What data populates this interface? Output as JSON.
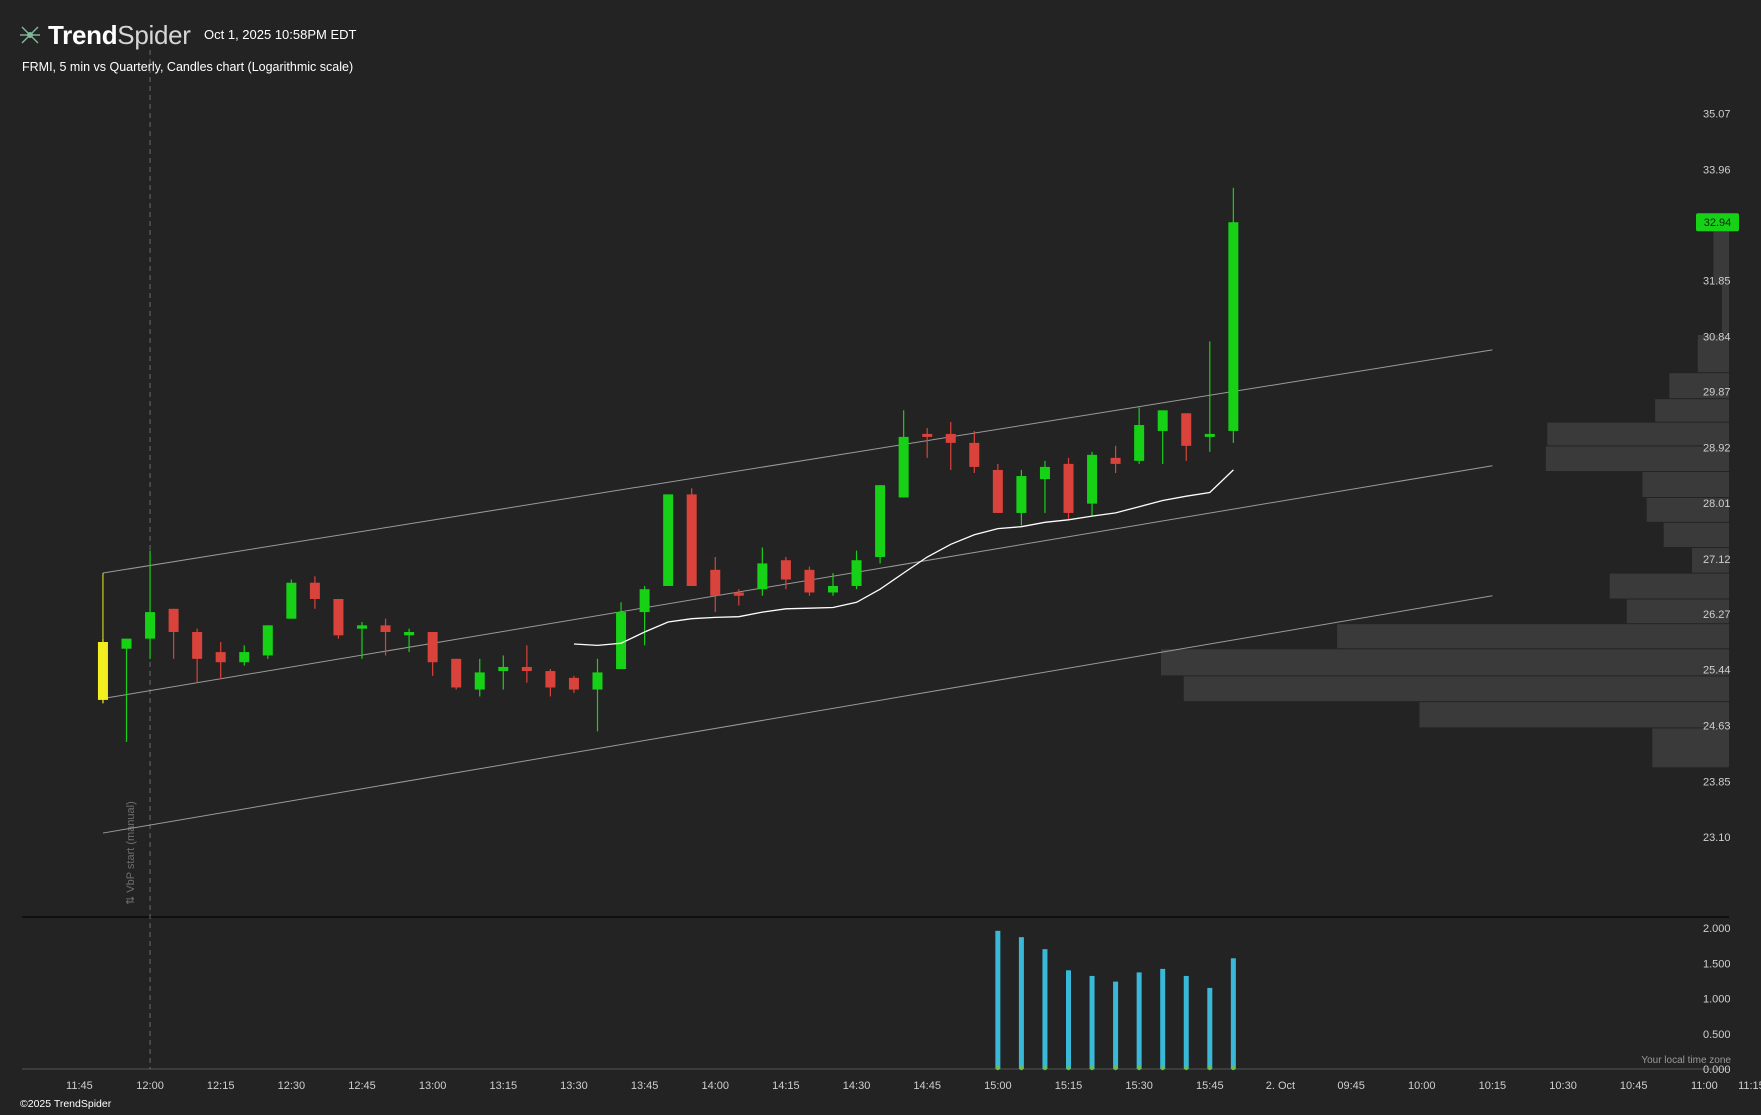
{
  "header": {
    "brand_bold": "Trend",
    "brand_light": "Spider",
    "datetime": "Oct 1, 2025 10:58PM EDT",
    "subtitle": "FRMI, 5 min vs Quarterly, Candles chart (Logarithmic scale)"
  },
  "footer": {
    "copyright": "©2025 TrendSpider",
    "timezone_note": "Your local time zone"
  },
  "annotation": {
    "vbp_label": "⇅ VbP start (manual)"
  },
  "colors": {
    "background": "#232323",
    "up": "#17d117",
    "down": "#d9433b",
    "highlight": "#f2ee20",
    "price_badge": "#17d117",
    "volume_bar": "#3ab8d8",
    "channel": "#9a9a9a",
    "vwap_line": "#ffffff",
    "profile_bar": "#3a3a3a"
  },
  "chart_data": [
    {
      "type": "candlestick",
      "title": "FRMI, 5 min vs Quarterly, Candles chart (Logarithmic scale)",
      "y_scale": "log",
      "ylim": [
        22.6,
        35.4
      ],
      "y_ticks": [
        "35.07",
        "33.96",
        "32.94",
        "31.85",
        "30.84",
        "29.87",
        "28.92",
        "28.01",
        "27.12",
        "26.27",
        "25.44",
        "24.63",
        "23.85",
        "23.10"
      ],
      "last_price": "32.94",
      "x_ticks": [
        "11:45",
        "12:00",
        "12:15",
        "12:30",
        "12:45",
        "13:00",
        "13:15",
        "13:30",
        "13:45",
        "14:00",
        "14:15",
        "14:30",
        "14:45",
        "15:00",
        "15:15",
        "15:30",
        "15:45",
        "2. Oct",
        "09:45",
        "10:00",
        "10:15",
        "10:30",
        "10:45",
        "11:00",
        "11:15"
      ],
      "x_tick_slots": [
        -2,
        1,
        4,
        7,
        10,
        13,
        16,
        19,
        22,
        25,
        28,
        31,
        34,
        37,
        40,
        43,
        46,
        49,
        52,
        55,
        58,
        61,
        64,
        67,
        69
      ],
      "candles": [
        {
          "t": "11:55",
          "o": 25.0,
          "h": 25.9,
          "l": 24.95,
          "c": 25.85,
          "highlight": true
        },
        {
          "t": "12:00",
          "o": 25.75,
          "h": 25.9,
          "l": 24.4,
          "c": 25.9
        },
        {
          "t": "12:05",
          "o": 25.9,
          "h": 27.25,
          "l": 25.6,
          "c": 26.3
        },
        {
          "t": "12:10",
          "o": 26.35,
          "h": 26.35,
          "l": 25.6,
          "c": 26.0
        },
        {
          "t": "12:15",
          "o": 26.0,
          "h": 26.05,
          "l": 25.25,
          "c": 25.6
        },
        {
          "t": "12:20",
          "o": 25.7,
          "h": 25.85,
          "l": 25.3,
          "c": 25.55
        },
        {
          "t": "12:25",
          "o": 25.55,
          "h": 25.8,
          "l": 25.5,
          "c": 25.7
        },
        {
          "t": "12:30",
          "o": 25.65,
          "h": 26.1,
          "l": 25.6,
          "c": 26.1
        },
        {
          "t": "12:35",
          "o": 26.2,
          "h": 26.8,
          "l": 26.2,
          "c": 26.75
        },
        {
          "t": "12:40",
          "o": 26.75,
          "h": 26.85,
          "l": 26.35,
          "c": 26.5
        },
        {
          "t": "12:45",
          "o": 26.5,
          "h": 26.5,
          "l": 25.9,
          "c": 25.95
        },
        {
          "t": "12:50",
          "o": 26.05,
          "h": 26.15,
          "l": 25.6,
          "c": 26.1
        },
        {
          "t": "12:55",
          "o": 26.1,
          "h": 26.2,
          "l": 25.65,
          "c": 26.0
        },
        {
          "t": "13:00",
          "o": 25.95,
          "h": 26.05,
          "l": 25.7,
          "c": 26.0
        },
        {
          "t": "13:05",
          "o": 26.0,
          "h": 26.0,
          "l": 25.35,
          "c": 25.55
        },
        {
          "t": "13:10",
          "o": 25.6,
          "h": 25.6,
          "l": 25.15,
          "c": 25.18
        },
        {
          "t": "13:15",
          "o": 25.15,
          "h": 25.6,
          "l": 25.05,
          "c": 25.4
        },
        {
          "t": "13:20",
          "o": 25.42,
          "h": 25.65,
          "l": 25.15,
          "c": 25.48
        },
        {
          "t": "13:25",
          "o": 25.48,
          "h": 25.8,
          "l": 25.25,
          "c": 25.42
        },
        {
          "t": "13:30",
          "o": 25.42,
          "h": 25.45,
          "l": 25.05,
          "c": 25.18
        },
        {
          "t": "13:35",
          "o": 25.32,
          "h": 25.35,
          "l": 25.1,
          "c": 25.15
        },
        {
          "t": "13:40",
          "o": 25.15,
          "h": 25.6,
          "l": 24.55,
          "c": 25.4
        },
        {
          "t": "13:45",
          "o": 25.45,
          "h": 26.45,
          "l": 25.45,
          "c": 26.3
        },
        {
          "t": "13:50",
          "o": 26.3,
          "h": 26.7,
          "l": 25.8,
          "c": 26.65
        },
        {
          "t": "13:55",
          "o": 26.7,
          "h": 28.15,
          "l": 26.7,
          "c": 28.15
        },
        {
          "t": "14:00",
          "o": 28.15,
          "h": 28.25,
          "l": 26.7,
          "c": 26.7
        },
        {
          "t": "14:05",
          "o": 26.95,
          "h": 27.15,
          "l": 26.3,
          "c": 26.55
        },
        {
          "t": "14:10",
          "o": 26.6,
          "h": 26.65,
          "l": 26.4,
          "c": 26.55
        },
        {
          "t": "14:15",
          "o": 26.65,
          "h": 27.3,
          "l": 26.55,
          "c": 27.05
        },
        {
          "t": "14:20",
          "o": 27.1,
          "h": 27.15,
          "l": 26.65,
          "c": 26.8
        },
        {
          "t": "14:25",
          "o": 26.95,
          "h": 27.0,
          "l": 26.55,
          "c": 26.6
        },
        {
          "t": "14:30",
          "o": 26.6,
          "h": 26.9,
          "l": 26.55,
          "c": 26.7
        },
        {
          "t": "14:35",
          "o": 26.7,
          "h": 27.25,
          "l": 26.65,
          "c": 27.1
        },
        {
          "t": "14:40",
          "o": 27.15,
          "h": 28.3,
          "l": 27.05,
          "c": 28.3
        },
        {
          "t": "14:45",
          "o": 28.1,
          "h": 29.55,
          "l": 28.1,
          "c": 29.1
        },
        {
          "t": "14:50",
          "o": 29.15,
          "h": 29.25,
          "l": 28.75,
          "c": 29.1
        },
        {
          "t": "14:55",
          "o": 29.15,
          "h": 29.35,
          "l": 28.55,
          "c": 29.0
        },
        {
          "t": "15:00",
          "o": 29.0,
          "h": 29.2,
          "l": 28.5,
          "c": 28.6
        },
        {
          "t": "15:05",
          "o": 28.55,
          "h": 28.65,
          "l": 27.85,
          "c": 27.85
        },
        {
          "t": "15:10",
          "o": 27.85,
          "h": 28.55,
          "l": 27.65,
          "c": 28.45
        },
        {
          "t": "15:15",
          "o": 28.4,
          "h": 28.7,
          "l": 27.85,
          "c": 28.6
        },
        {
          "t": "15:20",
          "o": 28.65,
          "h": 28.75,
          "l": 27.75,
          "c": 27.85
        },
        {
          "t": "15:25",
          "o": 28.0,
          "h": 28.85,
          "l": 27.8,
          "c": 28.8
        },
        {
          "t": "15:30",
          "o": 28.75,
          "h": 28.95,
          "l": 28.5,
          "c": 28.65
        },
        {
          "t": "15:35",
          "o": 28.7,
          "h": 29.6,
          "l": 28.65,
          "c": 29.3
        },
        {
          "t": "15:40",
          "o": 29.2,
          "h": 29.55,
          "l": 28.65,
          "c": 29.55
        },
        {
          "t": "15:45",
          "o": 29.5,
          "h": 29.5,
          "l": 28.7,
          "c": 28.95
        },
        {
          "t": "15:50",
          "o": 29.1,
          "h": 30.75,
          "l": 28.85,
          "c": 29.15
        },
        {
          "t": "15:55",
          "o": 29.2,
          "h": 33.6,
          "l": 29.0,
          "c": 32.94
        }
      ],
      "vwap": [
        {
          "t": "13:35",
          "v": 25.82
        },
        {
          "t": "13:40",
          "v": 25.8
        },
        {
          "t": "13:45",
          "v": 25.83
        },
        {
          "t": "13:50",
          "v": 26.0
        },
        {
          "t": "13:55",
          "v": 26.15
        },
        {
          "t": "14:00",
          "v": 26.2
        },
        {
          "t": "14:05",
          "v": 26.22
        },
        {
          "t": "14:10",
          "v": 26.23
        },
        {
          "t": "14:15",
          "v": 26.3
        },
        {
          "t": "14:20",
          "v": 26.35
        },
        {
          "t": "14:25",
          "v": 26.36
        },
        {
          "t": "14:30",
          "v": 26.37
        },
        {
          "t": "14:35",
          "v": 26.45
        },
        {
          "t": "14:40",
          "v": 26.65
        },
        {
          "t": "14:45",
          "v": 26.9
        },
        {
          "t": "14:50",
          "v": 27.15
        },
        {
          "t": "14:55",
          "v": 27.35
        },
        {
          "t": "15:00",
          "v": 27.5
        },
        {
          "t": "15:05",
          "v": 27.6
        },
        {
          "t": "15:10",
          "v": 27.63
        },
        {
          "t": "15:15",
          "v": 27.7
        },
        {
          "t": "15:20",
          "v": 27.74
        },
        {
          "t": "15:25",
          "v": 27.8
        },
        {
          "t": "15:30",
          "v": 27.85
        },
        {
          "t": "15:35",
          "v": 27.95
        },
        {
          "t": "15:40",
          "v": 28.05
        },
        {
          "t": "15:45",
          "v": 28.12
        },
        {
          "t": "15:50",
          "v": 28.18
        },
        {
          "t": "15:55",
          "v": 28.55
        }
      ],
      "channel": {
        "start_t": "11:55",
        "end_slot": 58,
        "upper": [
          26.9,
          30.6
        ],
        "middle": [
          25.02,
          28.62
        ],
        "lower": [
          23.15,
          26.55
        ]
      },
      "volume_profile": [
        {
          "price": 32.3,
          "size": 0.055
        },
        {
          "price": 31.3,
          "size": 0.025
        },
        {
          "price": 30.45,
          "size": 0.11
        },
        {
          "price": 29.95,
          "size": 0.21
        },
        {
          "price": 29.55,
          "size": 0.26
        },
        {
          "price": 29.15,
          "size": 0.64
        },
        {
          "price": 28.75,
          "size": 0.645
        },
        {
          "price": 28.3,
          "size": 0.305
        },
        {
          "price": 27.9,
          "size": 0.29
        },
        {
          "price": 27.5,
          "size": 0.23
        },
        {
          "price": 27.1,
          "size": 0.13
        },
        {
          "price": 26.7,
          "size": 0.42
        },
        {
          "price": 26.3,
          "size": 0.36
        },
        {
          "price": 25.95,
          "size": 1.38
        },
        {
          "price": 25.55,
          "size": 2.0
        },
        {
          "price": 25.15,
          "size": 1.92
        },
        {
          "price": 24.8,
          "size": 1.09
        },
        {
          "price": 24.4,
          "size": 0.27
        }
      ]
    },
    {
      "type": "bar",
      "title": "",
      "y_ticks": [
        "2.000",
        "1.500",
        "1.000",
        "0.500",
        "0.000"
      ],
      "ylim": [
        0,
        2.0
      ],
      "categories": [
        "15:05",
        "15:10",
        "15:15",
        "15:20",
        "15:25",
        "15:30",
        "15:35",
        "15:40",
        "15:45",
        "15:50",
        "15:55"
      ],
      "values": [
        1.96,
        1.87,
        1.7,
        1.4,
        1.32,
        1.24,
        1.37,
        1.42,
        1.32,
        1.15,
        1.57
      ]
    }
  ]
}
